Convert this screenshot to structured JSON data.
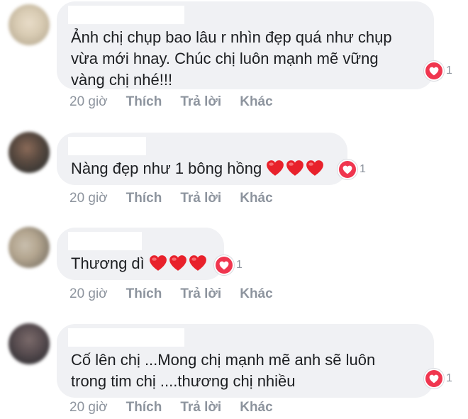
{
  "comments": [
    {
      "text": "Ảnh chị chụp bao lâu r nhìn đẹp quá như chụp\nvừa mới hnay. Chúc chị luôn mạnh mẽ vững\nvàng chị nhé!!!",
      "reaction_icon": "love-icon",
      "reaction_count": "1",
      "time": "20 giờ",
      "like": "Thích",
      "reply": "Trả lời",
      "more": "Khác"
    },
    {
      "text": "Nàng đẹp như 1 bông hồng",
      "inline_emoji": "red-heart-icon",
      "reaction_icon": "love-icon",
      "reaction_count": "1",
      "time": "20 giờ",
      "like": "Thích",
      "reply": "Trả lời",
      "more": "Khác"
    },
    {
      "text": "Thương dì",
      "inline_emoji": "red-heart-icon",
      "reaction_icon": "love-icon",
      "reaction_count": "1",
      "time": "20 giờ",
      "like": "Thích",
      "reply": "Trả lời",
      "more": "Khác"
    },
    {
      "text": "Cố lên chị ...Mong chị mạnh mẽ anh sẽ luôn\ntrong tim chị ....thương chị nhiều",
      "reaction_icon": "love-icon",
      "reaction_count": "1",
      "time": "20 giờ",
      "like": "Thích",
      "reply": "Trả lời",
      "more": "Khác"
    }
  ],
  "colors": {
    "bubble": "#f0f1f4",
    "text": "#1c1e21",
    "meta": "#8d949e",
    "love": "#f0364f",
    "heart": "#e8212b"
  }
}
